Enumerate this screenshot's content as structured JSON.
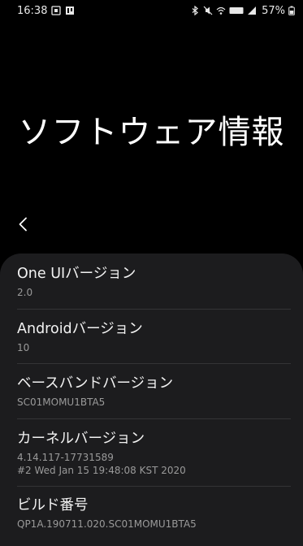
{
  "status_bar": {
    "time": "16:38",
    "battery_percent": "57%",
    "left_icons": [
      "image-notification-icon",
      "media-notification-icon"
    ],
    "right_icons": [
      "bluetooth-icon",
      "mute-icon",
      "wifi-icon",
      "volte-icon",
      "signal-icon",
      "battery-icon"
    ],
    "volte_label": "VoLTE"
  },
  "header": {
    "title": "ソフトウェア情報",
    "back_icon": "chevron-left-icon"
  },
  "items": [
    {
      "title": "One UIバージョン",
      "values": [
        "2.0"
      ]
    },
    {
      "title": "Androidバージョン",
      "values": [
        "10"
      ]
    },
    {
      "title": "ベースバンドバージョン",
      "values": [
        "SC01MOMU1BTA5"
      ]
    },
    {
      "title": "カーネルバージョン",
      "values": [
        "4.14.117-17731589",
        "#2 Wed Jan 15 19:48:08 KST 2020"
      ]
    },
    {
      "title": "ビルド番号",
      "values": [
        "QP1A.190711.020.SC01MOMU1BTA5"
      ]
    }
  ],
  "colors": {
    "background": "#000000",
    "card": "#1c1c1e",
    "primary_text": "#f2f2f2",
    "secondary_text": "#9a9a9a",
    "divider": "#343436"
  }
}
